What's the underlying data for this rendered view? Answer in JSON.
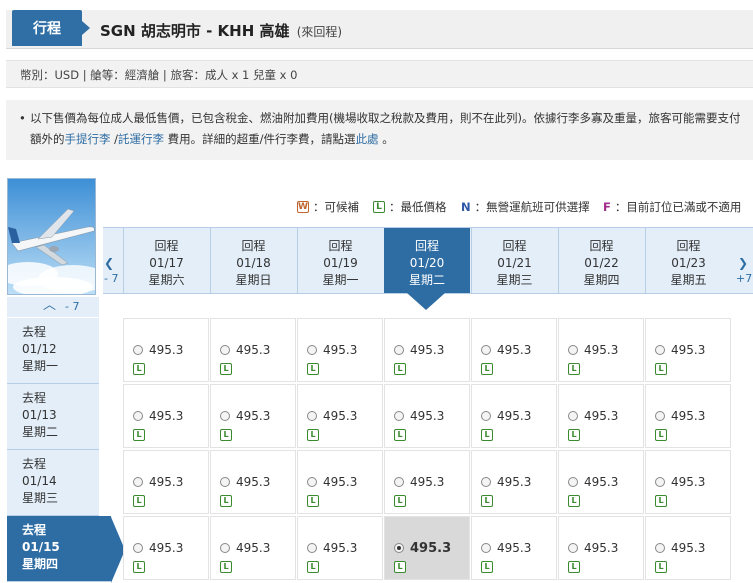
{
  "header": {
    "tab_label": "行程",
    "route": "SGN 胡志明市 - KHH 高雄",
    "trip_type": "(來回程)"
  },
  "info": "幣別：USD | 艙等：經濟艙 | 旅客：成人 x 1 兒童 x 0",
  "notice": {
    "text1": "以下售價為每位成人最低售價，已包含稅金、燃油附加費用(機場收取之稅款及費用，則不在此列)。依據行李多寡及重量，旅客可能需要支付額外的",
    "link1": "手提行李",
    "sep": " /",
    "link2": "託運行李",
    "text2": " 費用。詳細的超重/件行李費，請點選",
    "link3": "此處",
    "text3": " 。"
  },
  "legend": {
    "w_icon": "W",
    "w_text": "：可候補",
    "l_icon": "L",
    "l_text": "：最低價格",
    "n_icon": "N",
    "n_text": "：無營運航班可供選擇",
    "f_icon": "F",
    "f_text": "：目前訂位已滿或不適用"
  },
  "nav": {
    "prev_text": "- 7",
    "next_text": "+7",
    "up_text": "- 7"
  },
  "return_dates": [
    {
      "label": "回程",
      "date": "01/17",
      "weekday": "星期六"
    },
    {
      "label": "回程",
      "date": "01/18",
      "weekday": "星期日"
    },
    {
      "label": "回程",
      "date": "01/19",
      "weekday": "星期一"
    },
    {
      "label": "回程",
      "date": "01/20",
      "weekday": "星期二"
    },
    {
      "label": "回程",
      "date": "01/21",
      "weekday": "星期三"
    },
    {
      "label": "回程",
      "date": "01/22",
      "weekday": "星期四"
    },
    {
      "label": "回程",
      "date": "01/23",
      "weekday": "星期五"
    }
  ],
  "depart_dates": [
    {
      "label": "去程",
      "date": "01/12",
      "weekday": "星期一"
    },
    {
      "label": "去程",
      "date": "01/13",
      "weekday": "星期二"
    },
    {
      "label": "去程",
      "date": "01/14",
      "weekday": "星期三"
    },
    {
      "label": "去程",
      "date": "01/15",
      "weekday": "星期四"
    }
  ],
  "prices": [
    [
      "495.3",
      "495.3",
      "495.3",
      "495.3",
      "495.3",
      "495.3",
      "495.3"
    ],
    [
      "495.3",
      "495.3",
      "495.3",
      "495.3",
      "495.3",
      "495.3",
      "495.3"
    ],
    [
      "495.3",
      "495.3",
      "495.3",
      "495.3",
      "495.3",
      "495.3",
      "495.3"
    ],
    [
      "495.3",
      "495.3",
      "495.3",
      "495.3",
      "495.3",
      "495.3",
      "495.3"
    ]
  ],
  "fare_badge": "L",
  "colors": {
    "accent": "#2e6da4",
    "lowest_badge": "#3a8a2e",
    "waitlist": "#c0652f",
    "full": "#a02e8a"
  }
}
